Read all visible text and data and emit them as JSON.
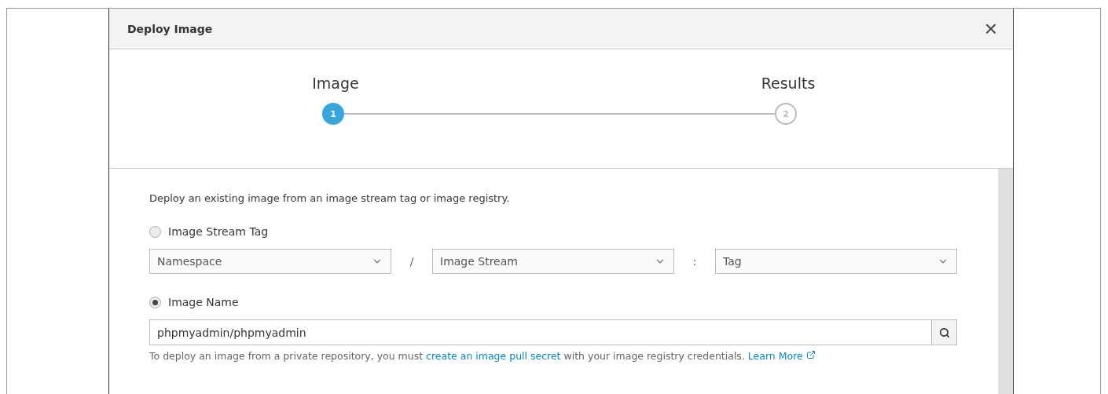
{
  "dialog": {
    "title": "Deploy Image",
    "close": "×"
  },
  "steps": [
    {
      "label": "Image",
      "number": "1",
      "selected": true
    },
    {
      "label": "Results",
      "number": "2",
      "selected": false
    }
  ],
  "intro": "Deploy an existing image from an image stream tag or image registry.",
  "sources": [
    {
      "label": "Image Stream Tag",
      "selected": false
    },
    {
      "label": "Image Name",
      "selected": true
    }
  ],
  "stream_tag": {
    "selects": [
      {
        "placeholder": "Namespace",
        "separator": "/"
      },
      {
        "placeholder": "Image Stream",
        "separator": ":"
      },
      {
        "placeholder": "Tag"
      }
    ]
  },
  "image_name": {
    "value": "phpmyadmin/phpmyadmin"
  },
  "help": {
    "before": "To deploy an image from a private repository, you must ",
    "link": "create an image pull secret",
    "after": " with your image registry credentials.",
    "learn_more": "Learn More"
  }
}
